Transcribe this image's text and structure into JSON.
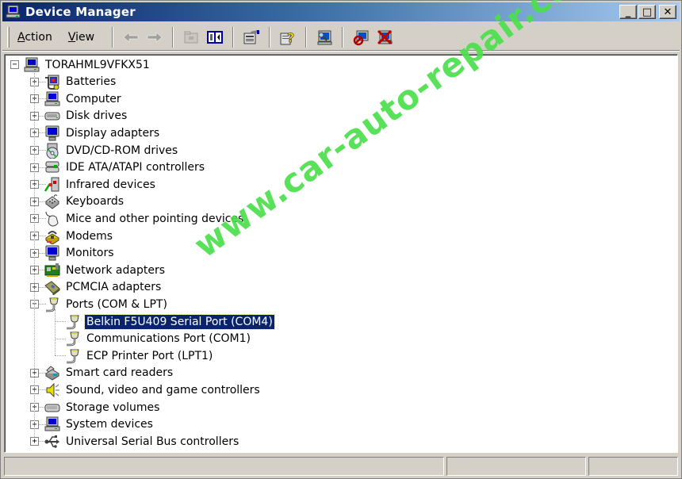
{
  "window": {
    "title": "Device Manager",
    "controls": {
      "minimize": "_",
      "maximize": "□",
      "close": "✕"
    }
  },
  "toolbar": {
    "menus": [
      {
        "label": "Action",
        "accel": "A"
      },
      {
        "label": "View",
        "accel": "V"
      }
    ],
    "buttons": [
      {
        "name": "back-button",
        "icon": "arrow-left-icon",
        "enabled": false
      },
      {
        "name": "forward-button",
        "icon": "arrow-right-icon",
        "enabled": false
      },
      {
        "name": "up-one-level-button",
        "icon": "folder-up-icon",
        "enabled": false
      },
      {
        "name": "show-hide-console-tree-button",
        "icon": "console-tree-icon",
        "enabled": true
      },
      {
        "name": "properties-button",
        "icon": "properties-icon",
        "enabled": true
      },
      {
        "name": "help-button",
        "icon": "help-icon",
        "enabled": true
      },
      {
        "name": "scan-hardware-changes-button",
        "icon": "scan-hardware-icon",
        "enabled": true
      },
      {
        "name": "disable-device-button",
        "icon": "disable-device-icon",
        "enabled": true
      },
      {
        "name": "uninstall-device-button",
        "icon": "uninstall-device-icon",
        "enabled": true
      }
    ]
  },
  "tree": {
    "root": {
      "label": "TORAHML9VFKX51",
      "icon": "computer-icon",
      "expanded": true
    },
    "categories": [
      {
        "label": "Batteries",
        "icon": "battery-icon",
        "expanded": false
      },
      {
        "label": "Computer",
        "icon": "computer-icon",
        "expanded": false
      },
      {
        "label": "Disk drives",
        "icon": "disk-drive-icon",
        "expanded": false
      },
      {
        "label": "Display adapters",
        "icon": "display-adapter-icon",
        "expanded": false
      },
      {
        "label": "DVD/CD-ROM drives",
        "icon": "cdrom-icon",
        "expanded": false
      },
      {
        "label": "IDE ATA/ATAPI controllers",
        "icon": "ide-controller-icon",
        "expanded": false
      },
      {
        "label": "Infrared devices",
        "icon": "infrared-icon",
        "expanded": false
      },
      {
        "label": "Keyboards",
        "icon": "keyboard-icon",
        "expanded": false
      },
      {
        "label": "Mice and other pointing devices",
        "icon": "mouse-icon",
        "expanded": false
      },
      {
        "label": "Modems",
        "icon": "modem-icon",
        "expanded": false
      },
      {
        "label": "Monitors",
        "icon": "monitor-icon",
        "expanded": false
      },
      {
        "label": "Network adapters",
        "icon": "network-adapter-icon",
        "expanded": false
      },
      {
        "label": "PCMCIA adapters",
        "icon": "pcmcia-icon",
        "expanded": false
      },
      {
        "label": "Ports (COM & LPT)",
        "icon": "port-icon",
        "expanded": true,
        "children": [
          {
            "label": "Belkin F5U409 Serial Port (COM4)",
            "icon": "port-icon",
            "selected": true
          },
          {
            "label": "Communications Port (COM1)",
            "icon": "port-icon",
            "selected": false
          },
          {
            "label": "ECP Printer Port (LPT1)",
            "icon": "port-icon",
            "selected": false
          }
        ]
      },
      {
        "label": "Smart card readers",
        "icon": "smart-card-icon",
        "expanded": false
      },
      {
        "label": "Sound, video and game controllers",
        "icon": "speaker-icon",
        "expanded": false
      },
      {
        "label": "Storage volumes",
        "icon": "storage-volume-icon",
        "expanded": false
      },
      {
        "label": "System devices",
        "icon": "computer-icon",
        "expanded": false
      },
      {
        "label": "Universal Serial Bus controllers",
        "icon": "usb-icon",
        "expanded": false
      }
    ]
  },
  "expander": {
    "collapsed": "+",
    "expanded": "−"
  },
  "statusbar": {
    "panels": [
      "",
      "",
      ""
    ]
  },
  "watermark": "www.car-auto-repair.com",
  "colors": {
    "selection": "#0a246a",
    "title_start": "#0a246a",
    "title_end": "#a6caf0",
    "watermark": "#4ce04c"
  }
}
